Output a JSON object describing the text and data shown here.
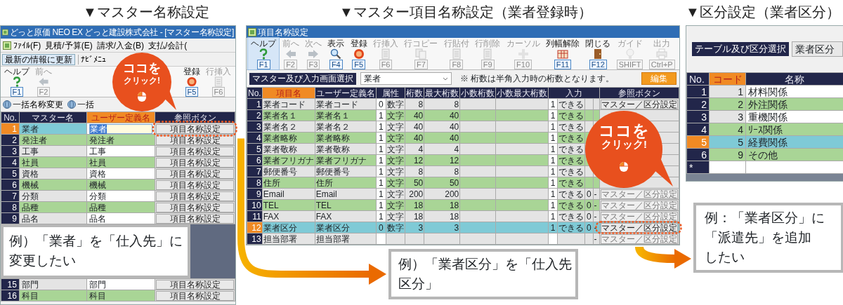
{
  "master_name_panel": {
    "heading": "▼マスター名称設定",
    "window_title": "どっと原価 NEO EX どっと建設株式会社 - [マスター名称設定]",
    "menu": [
      "ﾌｧｲﾙ(F)",
      "見積/予算(E)",
      "請求/入金(B)",
      "支払/会計("
    ],
    "quick_bar": [
      {
        "label": "最新の情報に更新",
        "kind": "button"
      },
      {
        "label": "ﾅﾋﾞﾒﾆｭ",
        "kind": "tab"
      }
    ],
    "toolbar": [
      {
        "label": "ヘルプ",
        "key": "F1",
        "kind": "help",
        "disabled": false
      },
      {
        "label": "前へ",
        "key": "F2",
        "kind": "back",
        "disabled": true
      },
      {
        "label": "登録",
        "key": "F5",
        "kind": "ok",
        "disabled": false
      },
      {
        "label": "行挿入",
        "key": "F6",
        "kind": "insert",
        "disabled": true
      }
    ],
    "bulk_actions": [
      "一括名称変更",
      "一括"
    ],
    "columns": [
      {
        "label": "No.",
        "active": false
      },
      {
        "label": "マスター名",
        "active": false
      },
      {
        "label": "ユーザー定義名",
        "active": true
      },
      {
        "label": "参照ボタン",
        "active": false
      }
    ],
    "rows": [
      {
        "no": "1",
        "master": "業者",
        "user": "業者",
        "button": "項目名称設定",
        "selected": true
      },
      {
        "no": "2",
        "master": "発注者",
        "user": "発注者",
        "button": "項目名称設定",
        "selected": false
      },
      {
        "no": "3",
        "master": "工事",
        "user": "工事",
        "button": "項目名称設定",
        "selected": false
      },
      {
        "no": "4",
        "master": "社員",
        "user": "社員",
        "button": "項目名称設定",
        "selected": false
      },
      {
        "no": "5",
        "master": "資格",
        "user": "資格",
        "button": "項目名称設定",
        "selected": false
      },
      {
        "no": "6",
        "master": "機械",
        "user": "機械",
        "button": "項目名称設定",
        "selected": false
      },
      {
        "no": "7",
        "master": "分類",
        "user": "分類",
        "button": "項目名称設定",
        "selected": false
      },
      {
        "no": "8",
        "master": "品種",
        "user": "品種",
        "button": "項目名称設定",
        "selected": false
      },
      {
        "no": "9",
        "master": "品名",
        "user": "品名",
        "button": "項目名称設定",
        "selected": false
      }
    ],
    "rows_below": [
      {
        "no": "15",
        "master": "部門",
        "user": "部門",
        "button": "項目名称設定",
        "selected": false
      },
      {
        "no": "16",
        "master": "科目",
        "user": "科目",
        "button": "項目名称設定",
        "selected": false
      }
    ],
    "callout_bubble": [
      "ココを",
      "クリック!"
    ],
    "example": [
      "例）「業者」を「仕入先」に",
      "変更したい"
    ]
  },
  "item_name_panel": {
    "heading": "▼マスター項目名称設定（業者登録時）",
    "window_title": "項目名称設定",
    "toolbar": [
      {
        "label": "ヘルプ",
        "key": "F1",
        "kind": "help",
        "disabled": false
      },
      {
        "label": "前へ",
        "key": "F2",
        "kind": "back",
        "disabled": true
      },
      {
        "label": "次へ",
        "key": "F3",
        "kind": "forward",
        "disabled": true
      },
      {
        "label": "表示",
        "key": "F4",
        "kind": "search",
        "disabled": false
      },
      {
        "label": "登録",
        "key": "F5",
        "kind": "ok",
        "disabled": false
      },
      {
        "label": "行挿入",
        "key": "F6",
        "kind": "insert",
        "disabled": true
      },
      {
        "label": "行コピー",
        "key": "F7",
        "kind": "copy",
        "disabled": true
      },
      {
        "label": "行貼付",
        "key": "F8",
        "kind": "paste",
        "disabled": true
      },
      {
        "label": "行削除",
        "key": "F9",
        "kind": "delete",
        "disabled": true
      },
      {
        "label": "カーソル",
        "key": "F10",
        "kind": "cursor",
        "disabled": true
      },
      {
        "label": "列幅解除",
        "key": "F11",
        "kind": "columns",
        "disabled": false
      },
      {
        "label": "閉じる",
        "key": "F12",
        "kind": "close",
        "disabled": false
      },
      {
        "label": "ガイド",
        "key": "SHIFT",
        "kind": "guide",
        "disabled": true
      },
      {
        "label": "出力",
        "key": "Ctrl+P",
        "kind": "print",
        "disabled": true
      }
    ],
    "edit_button": "編集",
    "selector_label": "マスター及び入力画面選択",
    "selector_value": "業者",
    "note": "※ 桁数は半角入力時の桁数となります。",
    "columns": [
      {
        "label": "No.",
        "kind": "single",
        "active": false
      },
      {
        "label": "項目名",
        "kind": "single",
        "active": true
      },
      {
        "label": "ユーザー定義名",
        "kind": "single",
        "active": false
      },
      {
        "label": "属性",
        "kind": "pair",
        "active": false
      },
      {
        "label": "桁数",
        "kind": "single",
        "active": false
      },
      {
        "label": "最大桁数",
        "kind": "single",
        "active": false
      },
      {
        "label": "小数桁数",
        "kind": "single",
        "active": false
      },
      {
        "label": "小数最大桁数",
        "kind": "single",
        "active": false
      },
      {
        "label": "入力",
        "kind": "quad",
        "active": false
      },
      {
        "label": "参照ボタン",
        "kind": "single",
        "active": false
      }
    ],
    "rows": [
      {
        "no": "1",
        "item": "業者コード",
        "user": "業者コード",
        "attr_code": "0",
        "attr_type": "数字",
        "digits": "8",
        "max_digits": "8",
        "in_count": "1",
        "in_mode": "できる",
        "ref": {
          "label": "マスター／区分設定",
          "disabled": false
        },
        "selected": false
      },
      {
        "no": "2",
        "item": "業者名１",
        "user": "業者名１",
        "attr_code": "1",
        "attr_type": "文字",
        "digits": "40",
        "max_digits": "40",
        "in_count": "1",
        "in_mode": "できる",
        "selected": false
      },
      {
        "no": "3",
        "item": "業者名２",
        "user": "業者名２",
        "attr_code": "1",
        "attr_type": "文字",
        "digits": "40",
        "max_digits": "40",
        "in_count": "1",
        "in_mode": "できる",
        "selected": false
      },
      {
        "no": "4",
        "item": "業者略称",
        "user": "業者略称",
        "attr_code": "1",
        "attr_type": "文字",
        "digits": "40",
        "max_digits": "40",
        "in_count": "1",
        "in_mode": "できる",
        "selected": false
      },
      {
        "no": "5",
        "item": "業者敬称",
        "user": "業者敬称",
        "attr_code": "1",
        "attr_type": "文字",
        "digits": "4",
        "max_digits": "4",
        "in_count": "1",
        "in_mode": "できる",
        "selected": false
      },
      {
        "no": "6",
        "item": "業者フリガナ",
        "user": "業者フリガナ",
        "attr_code": "1",
        "attr_type": "文字",
        "digits": "12",
        "max_digits": "12",
        "in_count": "1",
        "in_mode": "できる",
        "selected": false
      },
      {
        "no": "7",
        "item": "郵便番号",
        "user": "郵便番号",
        "attr_code": "1",
        "attr_type": "文字",
        "digits": "8",
        "max_digits": "8",
        "in_count": "1",
        "in_mode": "できる",
        "selected": false
      },
      {
        "no": "8",
        "item": "住所",
        "user": "住所",
        "attr_code": "1",
        "attr_type": "文字",
        "digits": "50",
        "max_digits": "50",
        "in_count": "1",
        "in_mode": "できる",
        "selected": false
      },
      {
        "no": "9",
        "item": "Email",
        "user": "Email",
        "attr_code": "1",
        "attr_type": "文字",
        "digits": "200",
        "max_digits": "200",
        "in_count": "1",
        "in_mode": "できる",
        "in_zero": "0",
        "in_dash": "-",
        "ref": {
          "label": "マスター／区分設定",
          "disabled": true
        },
        "selected": false
      },
      {
        "no": "10",
        "item": "TEL",
        "user": "TEL",
        "attr_code": "1",
        "attr_type": "文字",
        "digits": "18",
        "max_digits": "18",
        "in_count": "1",
        "in_mode": "できる",
        "in_zero": "0",
        "in_dash": "-",
        "ref": {
          "label": "マスター／区分設定",
          "disabled": true
        },
        "selected": false
      },
      {
        "no": "11",
        "item": "FAX",
        "user": "FAX",
        "attr_code": "1",
        "attr_type": "文字",
        "digits": "18",
        "max_digits": "18",
        "in_count": "1",
        "in_mode": "できる",
        "in_zero": "0",
        "in_dash": "-",
        "ref": {
          "label": "マスター／区分設定",
          "disabled": true
        },
        "selected": false
      },
      {
        "no": "12",
        "item": "業者区分",
        "user": "業者区分",
        "attr_code": "0",
        "attr_type": "数字",
        "digits": "3",
        "max_digits": "3",
        "in_count": "1",
        "in_mode": "できる",
        "in_zero": "0",
        "in_dash": "-",
        "ref": {
          "label": "マスター／区分設定",
          "disabled": false
        },
        "selected": true
      },
      {
        "no": "13",
        "item": "担当部署",
        "user": "担当部署",
        "in_dash": "-",
        "ref": {
          "label": "マスター／区分設定",
          "disabled": true
        },
        "selected": false
      }
    ],
    "callout_bubble": [
      "ココを",
      "クリック!"
    ],
    "example": [
      "例）「業者区分」を「仕入先",
      "区分」"
    ]
  },
  "category_panel": {
    "heading": "▼区分設定（業者区分）",
    "selector_label": "テーブル及び区分選択",
    "selector_value": "業者区分",
    "columns": [
      {
        "label": "No.",
        "active": false
      },
      {
        "label": "コード",
        "active": true
      },
      {
        "label": "名称",
        "active": false
      }
    ],
    "rows": [
      {
        "no": "1",
        "code": "1",
        "name": "材料関係",
        "selected": false
      },
      {
        "no": "2",
        "code": "2",
        "name": "外注関係",
        "selected": false
      },
      {
        "no": "3",
        "code": "3",
        "name": "重機関係",
        "selected": false
      },
      {
        "no": "4",
        "code": "4",
        "name": "ﾘｰｽ関係",
        "selected": false
      },
      {
        "no": "5",
        "code": "5",
        "name": "経費関係",
        "selected": true
      },
      {
        "no": "6",
        "code": "9",
        "name": "その他",
        "selected": false
      }
    ],
    "new_row_marker": "*",
    "example": [
      "例：「業者区分」に",
      "「派遣先」を追加",
      "したい"
    ]
  }
}
